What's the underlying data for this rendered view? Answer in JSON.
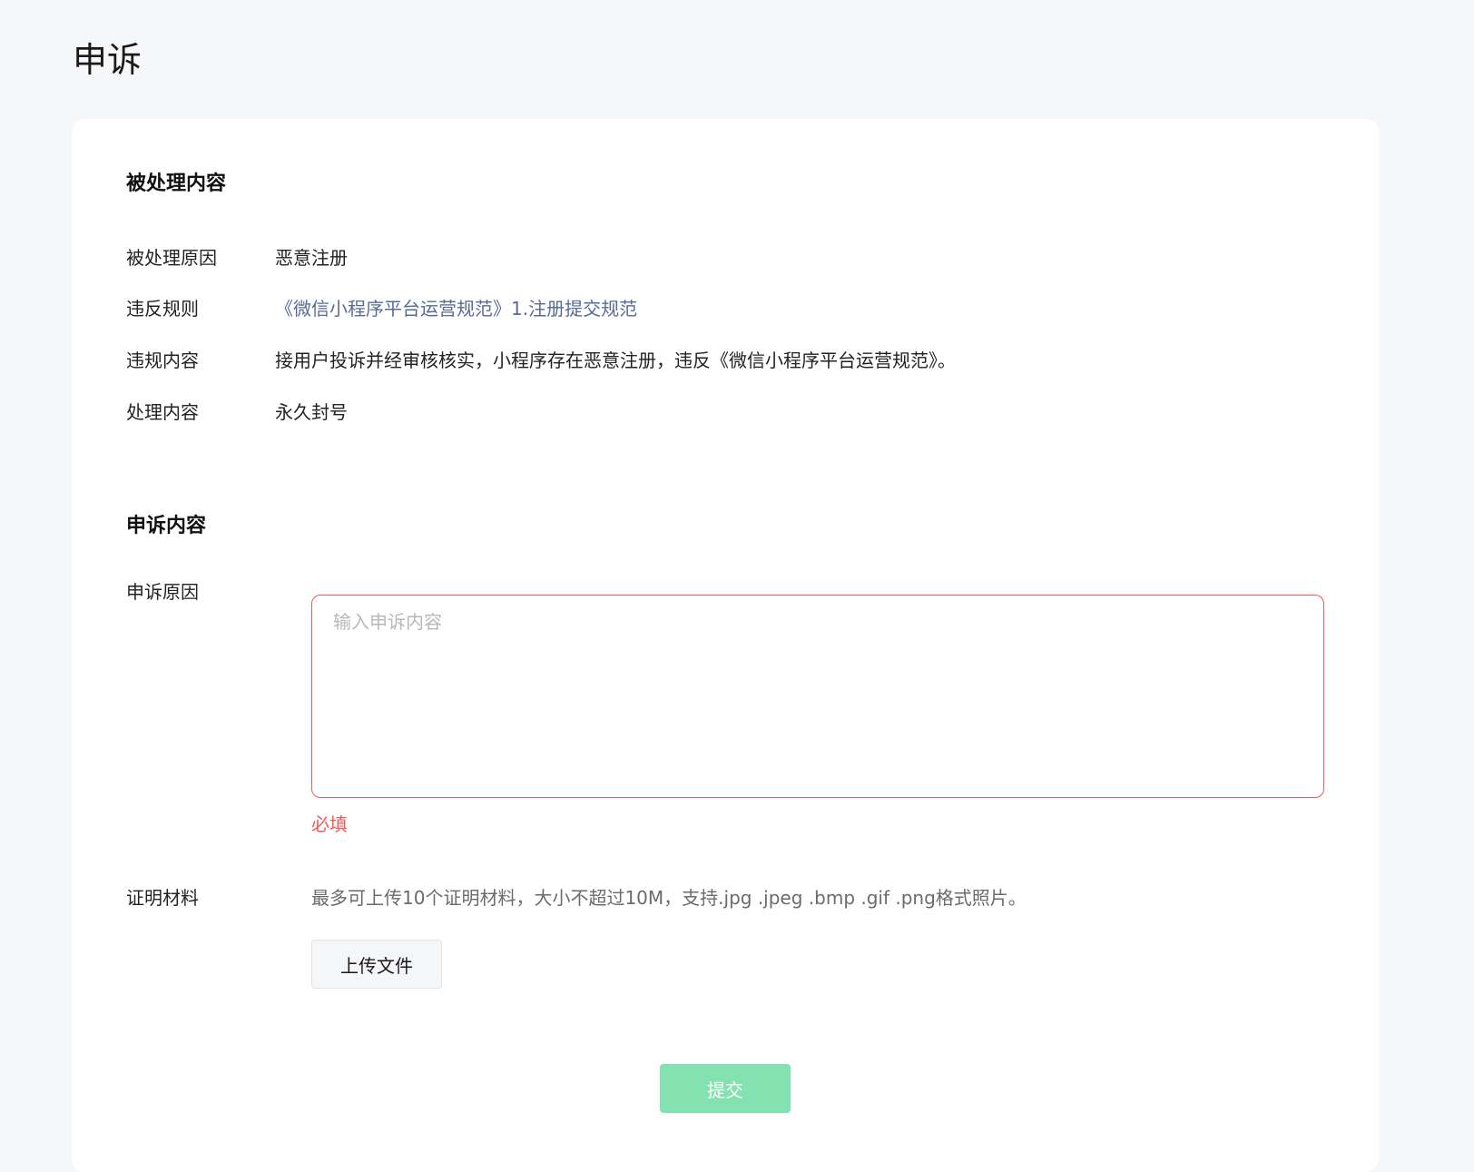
{
  "page": {
    "title": "申诉"
  },
  "processed": {
    "section_title": "被处理内容",
    "rows": [
      {
        "label": "被处理原因",
        "value": "恶意注册"
      },
      {
        "label": "违反规则",
        "value": "《微信小程序平台运营规范》1.注册提交规范"
      },
      {
        "label": "违规内容",
        "value": "接用户投诉并经审核核实，小程序存在恶意注册，违反《微信小程序平台运营规范》。"
      },
      {
        "label": "处理内容",
        "value": "永久封号"
      }
    ]
  },
  "appeal": {
    "section_title": "申诉内容",
    "reason_label": "申诉原因",
    "reason_placeholder": "输入申诉内容",
    "reason_value": "",
    "required_text": "必填",
    "evidence_label": "证明材料",
    "evidence_hint": "最多可上传10个证明材料，大小不超过10M，支持.jpg .jpeg .bmp .gif .png格式照片。",
    "upload_label": "上传文件",
    "submit_label": "提交"
  },
  "colors": {
    "page_background": "#f6f7f9",
    "card_background": "#ffffff",
    "link": "#576b95",
    "error": "#f15a5a",
    "submit_disabled": "#84e1b0"
  }
}
